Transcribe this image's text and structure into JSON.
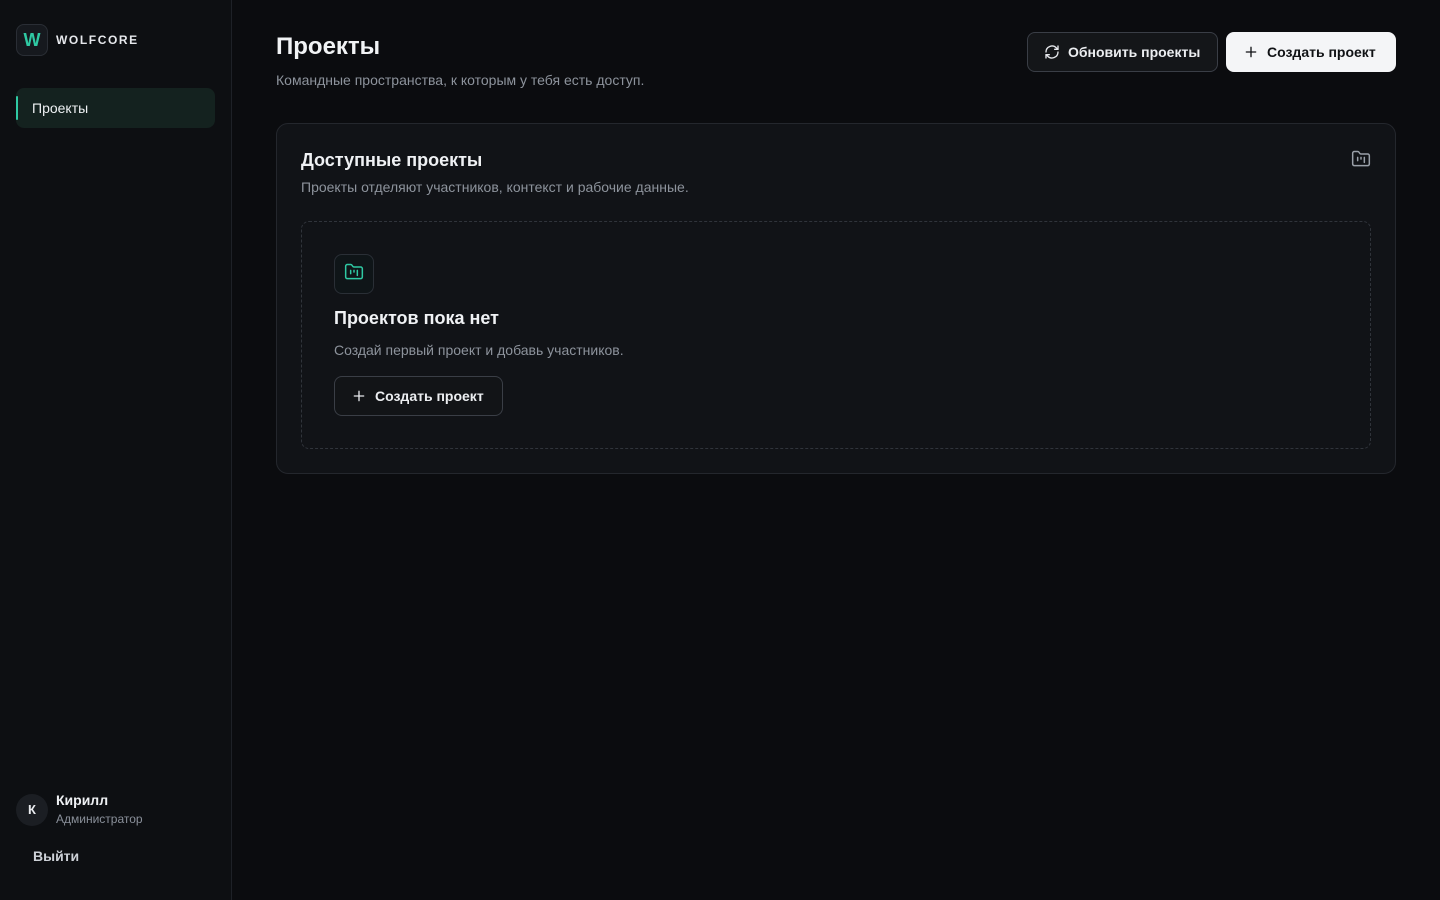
{
  "brand": {
    "logo_letter": "W",
    "name": "WOLFCORE"
  },
  "sidebar": {
    "items": [
      {
        "label": "Проекты",
        "active": true
      }
    ]
  },
  "user": {
    "initial": "К",
    "name": "Кирилл",
    "role": "Администратор"
  },
  "logout_label": "Выйти",
  "page": {
    "title": "Проекты",
    "subtitle": "Командные пространства, к которым у тебя есть доступ."
  },
  "toolbar": {
    "refresh_label": "Обновить проекты",
    "create_label": "Создать проект"
  },
  "card": {
    "title": "Доступные проекты",
    "subtitle": "Проекты отделяют участников, контекст и рабочие данные.",
    "empty": {
      "title": "Проектов пока нет",
      "description": "Создай первый проект и добавь участников.",
      "button_label": "Создать проект"
    }
  },
  "icons": {
    "refresh": "refresh-icon",
    "plus": "plus-icon",
    "folder": "folder-kanban-icon"
  },
  "colors": {
    "accent": "#2fc9a3",
    "background": "#0b0c0f",
    "card": "#111317"
  }
}
